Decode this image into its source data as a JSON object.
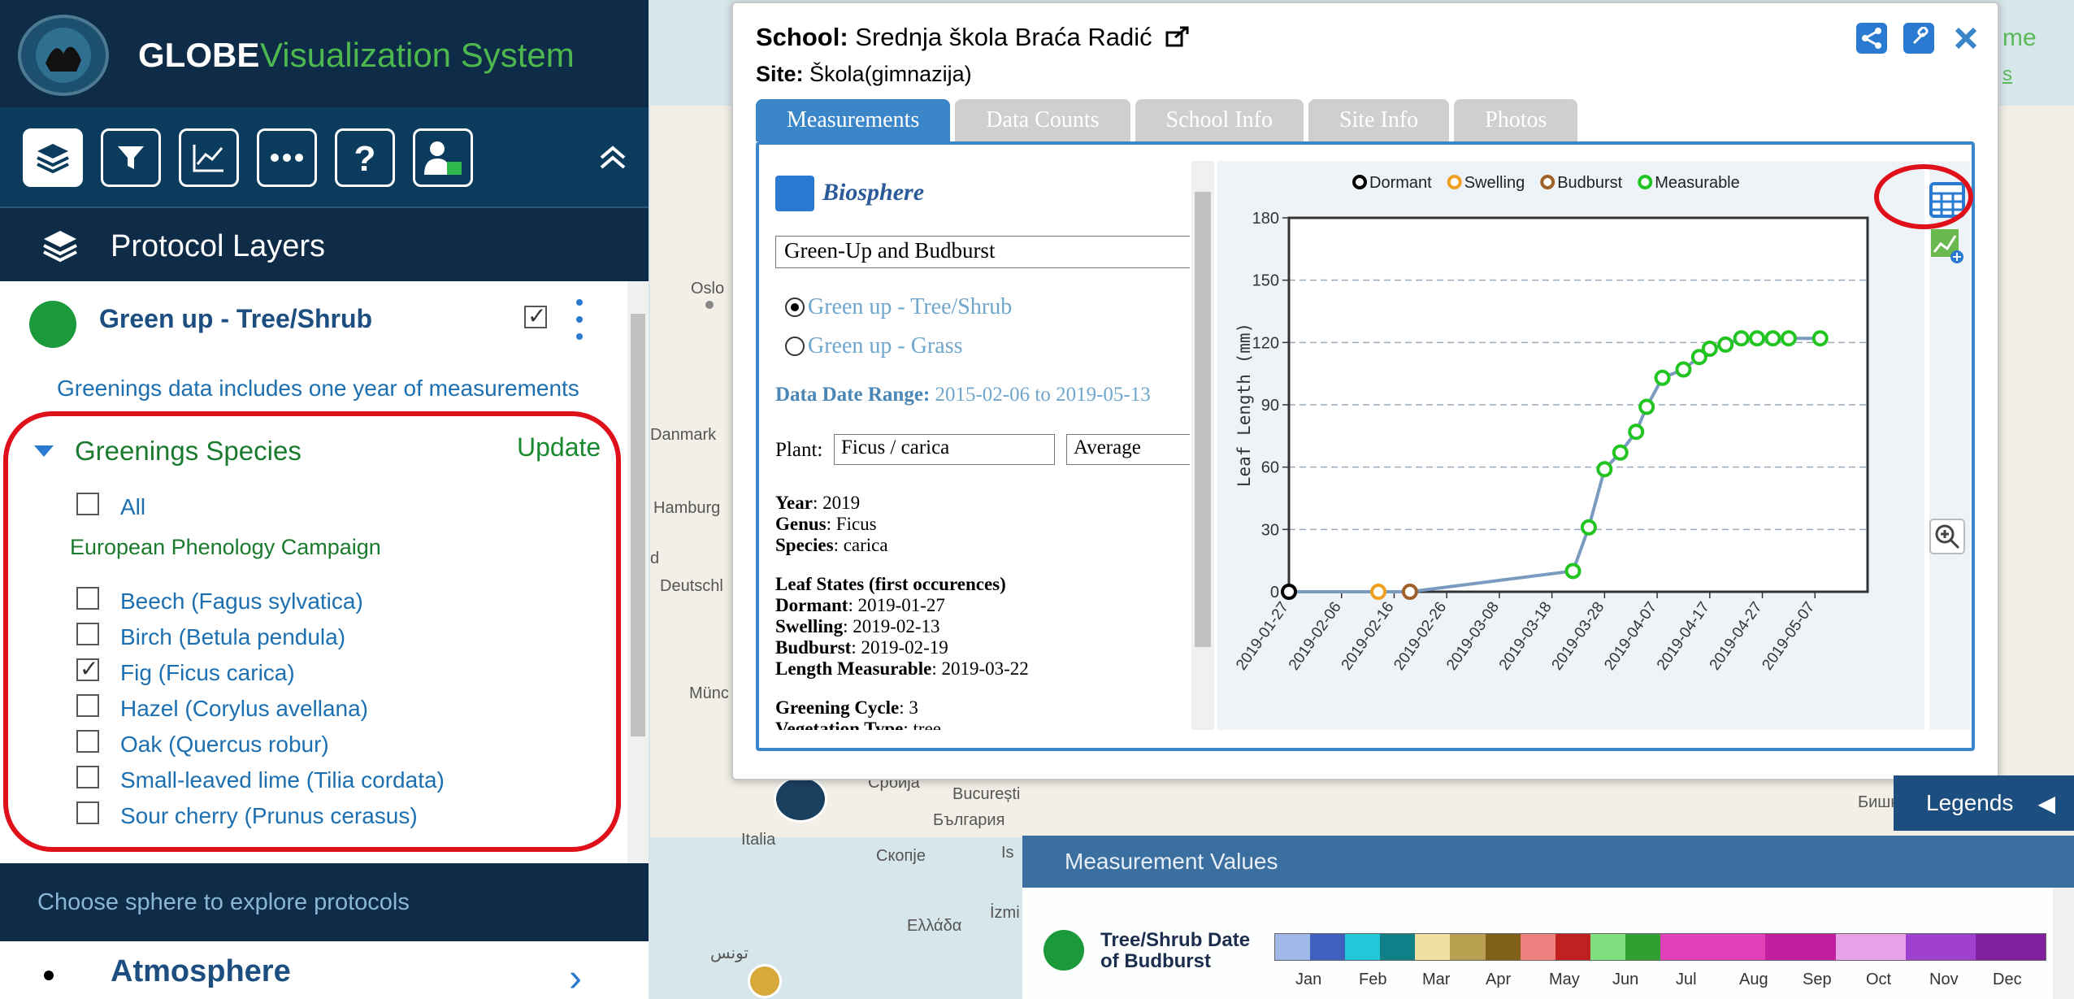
{
  "app": {
    "title_bold": "GLOBE",
    "title_rest": "Visualization System"
  },
  "top_right": {
    "text": "me",
    "link": "s"
  },
  "sidebar": {
    "section_title": "Protocol Layers",
    "protocol": {
      "name": "Green up - Tree/Shrub",
      "checked": true,
      "info": "Greenings data includes one year of measurements"
    },
    "species": {
      "header": "Greenings Species",
      "update": "Update",
      "all_label": "All",
      "campaign": "European Phenology Campaign",
      "items": [
        {
          "label": "Beech (Fagus sylvatica)",
          "checked": false
        },
        {
          "label": "Birch (Betula pendula)",
          "checked": false
        },
        {
          "label": "Fig (Ficus carica)",
          "checked": true
        },
        {
          "label": "Hazel (Corylus avellana)",
          "checked": false
        },
        {
          "label": "Oak (Quercus robur)",
          "checked": false
        },
        {
          "label": "Small-leaved lime (Tilia cordata)",
          "checked": false
        },
        {
          "label": "Sour cherry (Prunus cerasus)",
          "checked": false
        }
      ]
    },
    "choose_sphere": "Choose sphere to explore protocols",
    "sphere": "Atmosphere"
  },
  "map_labels": {
    "oslo": "Oslo",
    "danmark": "Danmark",
    "hamburg": "Hamburg",
    "deutschland": "Deutschl",
    "d": "d",
    "munchen": "Münc",
    "srbija": "Србија",
    "bucuresti": "București",
    "bulgaria": "България",
    "italia": "Italia",
    "skopje": "Скопје",
    "ellada": "Ελλάδα",
    "izmir": "İzmi",
    "tunis": "تونس",
    "is": "Is",
    "bishkek": "Бишкек"
  },
  "popup": {
    "school_label": "School:",
    "school_name": "Srednja škola Braća Radić",
    "site_label": "Site:",
    "site_name": "Škola(gimnazija)",
    "tabs": [
      "Measurements",
      "Data Counts",
      "School Info",
      "Site Info",
      "Photos"
    ],
    "sphere_title": "Biosphere",
    "protocol_select": "Green-Up and Budburst",
    "radio_tree": "Green up - Tree/Shrub",
    "radio_grass": "Green up - Grass",
    "range_label": "Data Date Range:",
    "range_value": "2015-02-06 to 2019-05-13",
    "plant_label": "Plant:",
    "plant_value": "Ficus / carica",
    "stat_value": "Average",
    "details": {
      "year_label": "Year",
      "year": "2019",
      "genus_label": "Genus",
      "genus": "Ficus",
      "species_label": "Species",
      "species": "carica",
      "leaf_states_label": "Leaf States (first occurences)",
      "dormant_label": "Dormant",
      "dormant": "2019-01-27",
      "swelling_label": "Swelling",
      "swelling": "2019-02-13",
      "budburst_label": "Budburst",
      "budburst": "2019-02-19",
      "measurable_label": "Length Measurable",
      "measurable": "2019-03-22",
      "cycle_label": "Greening Cycle",
      "cycle": "3",
      "veg_label": "Vegetation Type",
      "veg": "tree"
    }
  },
  "chart_data": {
    "type": "line",
    "title": "",
    "xlabel": "",
    "ylabel": "Leaf Length (mm)",
    "ylim": [
      0,
      180
    ],
    "yticks": [
      0,
      30,
      60,
      90,
      120,
      150,
      180
    ],
    "xtick_labels": [
      "2019-01-27",
      "2019-02-06",
      "2019-02-16",
      "2019-02-26",
      "2019-03-08",
      "2019-03-18",
      "2019-03-28",
      "2019-04-07",
      "2019-04-17",
      "2019-04-27",
      "2019-05-07"
    ],
    "xlim": [
      "2019-01-27",
      "2019-05-17"
    ],
    "legend_position": "top",
    "series": [
      {
        "name": "Dormant",
        "color": "#000000",
        "points": [
          [
            "2019-01-27",
            0
          ]
        ]
      },
      {
        "name": "Swelling",
        "color": "#f0a020",
        "points": [
          [
            "2019-02-13",
            0
          ]
        ]
      },
      {
        "name": "Budburst",
        "color": "#a0602a",
        "points": [
          [
            "2019-02-19",
            0
          ]
        ]
      },
      {
        "name": "Measurable",
        "color": "#22c422",
        "points": [
          [
            "2019-03-22",
            10
          ],
          [
            "2019-03-25",
            31
          ],
          [
            "2019-03-28",
            59
          ],
          [
            "2019-03-31",
            67
          ],
          [
            "2019-04-03",
            77
          ],
          [
            "2019-04-05",
            89
          ],
          [
            "2019-04-08",
            103
          ],
          [
            "2019-04-12",
            107
          ],
          [
            "2019-04-15",
            113
          ],
          [
            "2019-04-17",
            117
          ],
          [
            "2019-04-20",
            119
          ],
          [
            "2019-04-23",
            122
          ],
          [
            "2019-04-26",
            122
          ],
          [
            "2019-04-29",
            122
          ],
          [
            "2019-05-02",
            122
          ],
          [
            "2019-05-08",
            122
          ]
        ]
      }
    ],
    "line_color": "#7a9ac0",
    "grid": true
  },
  "legends_label": "Legends",
  "measurement_panel": {
    "title": "Measurement Values",
    "layer_label_1": "Tree/Shrub Date",
    "layer_label_2": "of Budburst",
    "months": [
      "Jan",
      "Feb",
      "Mar",
      "Apr",
      "May",
      "Jun",
      "Jul",
      "Aug",
      "Sep",
      "Oct",
      "Nov",
      "Dec"
    ],
    "scale_colors": [
      "#a0b8e8",
      "#4060c0",
      "#20c8d8",
      "#108088",
      "#f0e0a0",
      "#b8a050",
      "#806018",
      "#f08080",
      "#c02020",
      "#80e080",
      "#30a030",
      "#e040b8",
      "#e040b8",
      "#e040b8",
      "#c020a0",
      "#c020a0",
      "#e8a0e8",
      "#e8a0e8",
      "#a040d0",
      "#a040d0",
      "#8020a0",
      "#8020a0"
    ]
  }
}
